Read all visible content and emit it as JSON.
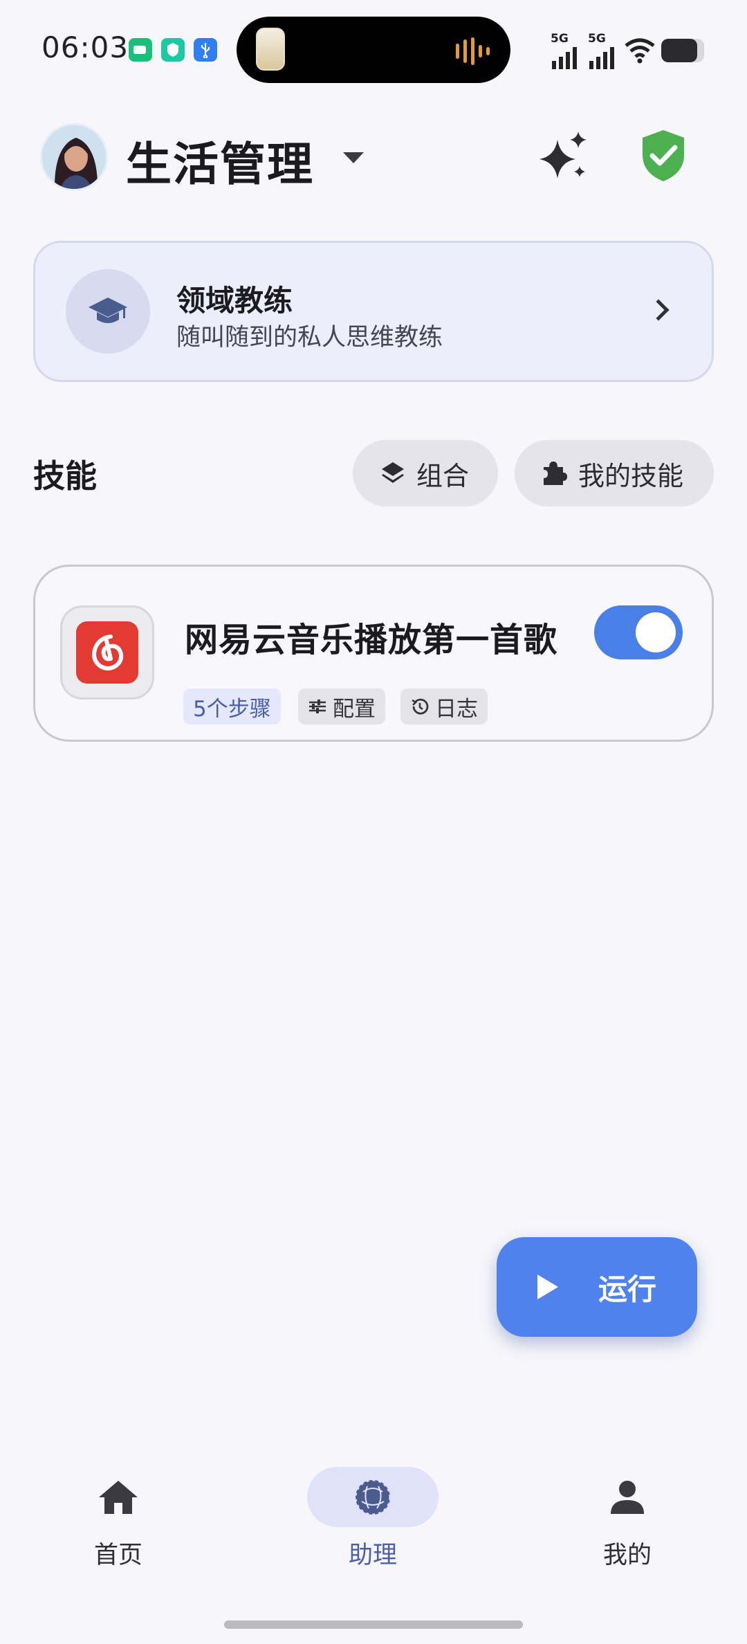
{
  "status_bar": {
    "time": "06:03",
    "left_icons": [
      "battery-saver-icon",
      "vpn-shield-icon",
      "usb-icon"
    ],
    "signal_labels": [
      "5G",
      "5G"
    ],
    "right_icons": [
      "signal-icon",
      "signal-icon",
      "wifi-icon",
      "battery-icon"
    ],
    "battery_level": 0.84
  },
  "header": {
    "title": "生活管理",
    "avatar": "avatar",
    "icons": [
      "chevron-down-icon",
      "sparkle-icon",
      "shield-check-icon"
    ],
    "colors": {
      "shield": "#4caf50"
    }
  },
  "coach_card": {
    "title": "领域教练",
    "subtitle": "随叫随到的私人思维教练",
    "icon": "graduation-cap-icon"
  },
  "skills": {
    "title": "技能",
    "combine_label": "组合",
    "my_skills_label": "我的技能",
    "items": [
      {
        "name": "网易云音乐播放第一首歌",
        "enabled": true,
        "steps_tag": "5个步骤",
        "config_tag": "配置",
        "log_tag": "日志",
        "app_icon": "netease-music-icon"
      }
    ]
  },
  "run_button": {
    "label": "运行"
  },
  "bottom_nav": {
    "items": [
      {
        "label": "首页",
        "icon": "home-icon",
        "active": false
      },
      {
        "label": "助理",
        "icon": "assistant-icon",
        "active": true
      },
      {
        "label": "我的",
        "icon": "person-icon",
        "active": false
      }
    ]
  },
  "colors": {
    "accent": "#4f82ec",
    "active_nav_bg": "#dfe2f8",
    "coach_bg": "#eceefc"
  }
}
